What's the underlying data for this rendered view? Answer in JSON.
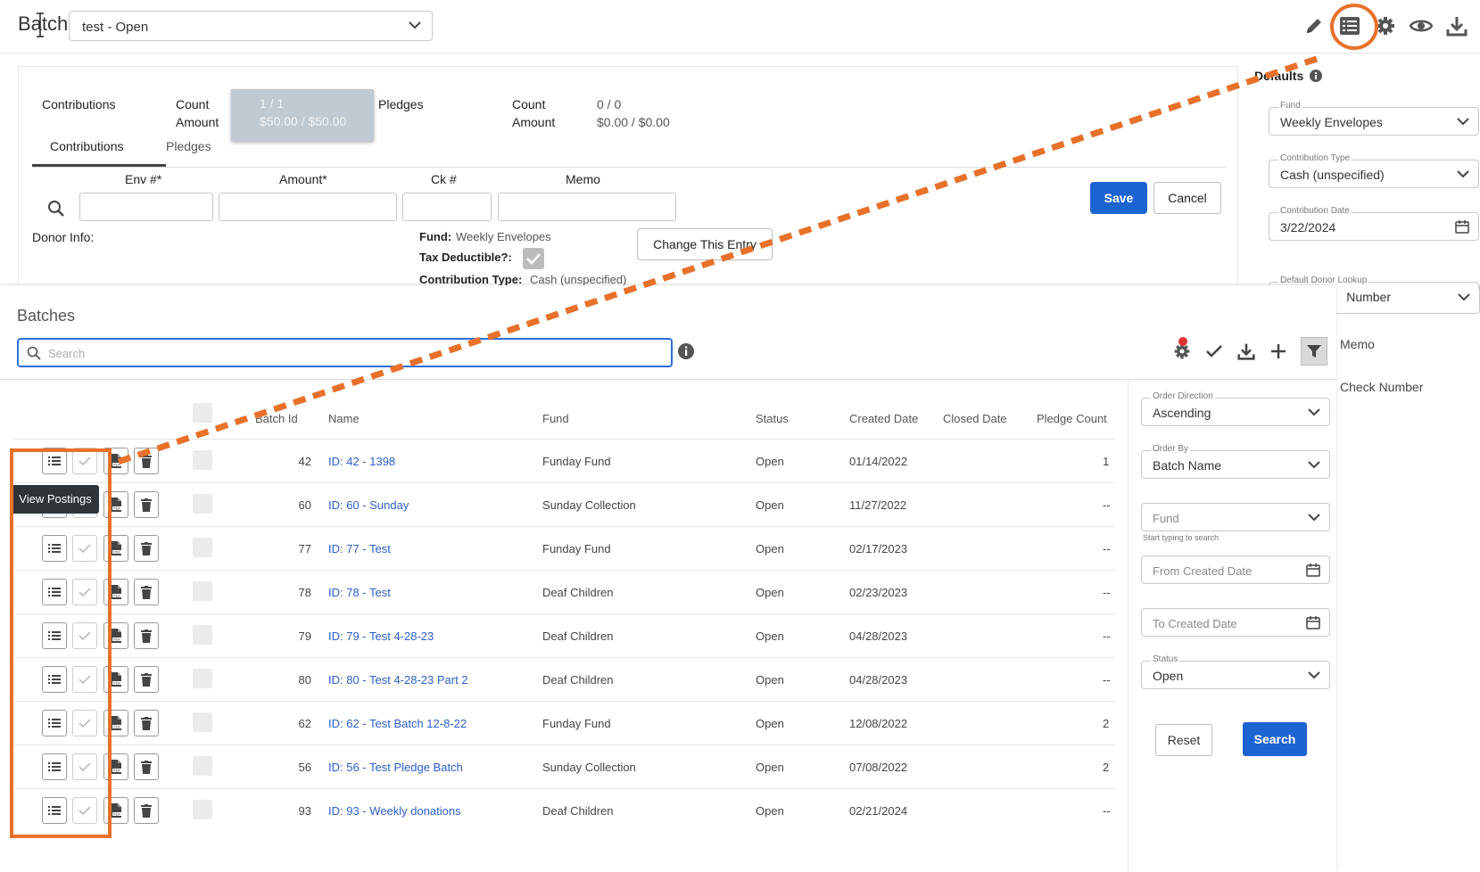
{
  "batch": {
    "title": "Batch",
    "selected": "test - Open"
  },
  "summary": {
    "contributions_label": "Contributions",
    "pledges_label": "Pledges",
    "count_label": "Count",
    "amount_label": "Amount",
    "contrib_count": "1 / 1",
    "contrib_amount": "$50.00 / $50.00",
    "pledge_count": "0 / 0",
    "pledge_amount": "$0.00 / $0.00"
  },
  "entry": {
    "tabs": [
      "Contributions",
      "Pledges"
    ],
    "columns": [
      "Env #*",
      "Amount*",
      "Ck #",
      "Memo"
    ],
    "save": "Save",
    "cancel": "Cancel",
    "donor_info_label": "Donor Info:",
    "fund_label": "Fund:",
    "fund_value": "Weekly Envelopes",
    "tax_label": "Tax Deductible?:",
    "ctype_label": "Contribution Type:",
    "ctype_value": "Cash (unspecified)",
    "change_button": "Change This Entry"
  },
  "defaults": {
    "title": "Defaults",
    "fund_label": "Fund",
    "fund_value": "Weekly Envelopes",
    "ctype_label": "Contribution Type",
    "ctype_value": "Cash (unspecified)",
    "date_label": "Contribution Date",
    "date_value": "3/22/2024",
    "lookup_label": "Default Donor Lookup",
    "lookup_value": "Number",
    "memo": "Memo",
    "check_number": "Check Number"
  },
  "batches": {
    "title": "Batches",
    "search_placeholder": "Search",
    "tooltip": "View Postings",
    "columns": {
      "batch_id": "Batch Id",
      "name": "Name",
      "fund": "Fund",
      "status": "Status",
      "created": "Created Date",
      "closed": "Closed Date",
      "pledge_count": "Pledge Count"
    },
    "rows": [
      {
        "id": "42",
        "name": "ID: 42 - 1398",
        "fund": "Funday Fund",
        "status": "Open",
        "created": "01/14/2022",
        "pledge": "1"
      },
      {
        "id": "60",
        "name": "ID: 60 - Sunday",
        "fund": "Sunday Collection",
        "status": "Open",
        "created": "11/27/2022",
        "pledge": "--"
      },
      {
        "id": "77",
        "name": "ID: 77 - Test",
        "fund": "Funday Fund",
        "status": "Open",
        "created": "02/17/2023",
        "pledge": "--"
      },
      {
        "id": "78",
        "name": "ID: 78 - Test",
        "fund": "Deaf Children",
        "status": "Open",
        "created": "02/23/2023",
        "pledge": "--"
      },
      {
        "id": "79",
        "name": "ID: 79 - Test 4-28-23",
        "fund": "Deaf Children",
        "status": "Open",
        "created": "04/28/2023",
        "pledge": "--"
      },
      {
        "id": "80",
        "name": "ID: 80 - Test 4-28-23 Part 2",
        "fund": "Deaf Children",
        "status": "Open",
        "created": "04/28/2023",
        "pledge": "--"
      },
      {
        "id": "62",
        "name": "ID: 62 - Test Batch 12-8-22",
        "fund": "Funday Fund",
        "status": "Open",
        "created": "12/08/2022",
        "pledge": "2"
      },
      {
        "id": "56",
        "name": "ID: 56 - Test Pledge Batch",
        "fund": "Sunday Collection",
        "status": "Open",
        "created": "07/08/2022",
        "pledge": "2"
      },
      {
        "id": "93",
        "name": "ID: 93 - Weekly donations",
        "fund": "Deaf Children",
        "status": "Open",
        "created": "02/21/2024",
        "pledge": "--"
      }
    ]
  },
  "filters": {
    "order_direction_label": "Order Direction",
    "order_direction_value": "Ascending",
    "order_by_label": "Order By",
    "order_by_value": "Batch Name",
    "fund_placeholder": "Fund",
    "fund_hint": "Start typing to search",
    "from_date_placeholder": "From Created Date",
    "to_date_placeholder": "To Created Date",
    "status_label": "Status",
    "status_value": "Open",
    "reset": "Reset",
    "search": "Search"
  },
  "colors": {
    "primary": "#1d64d3",
    "annotation": "#e8712a",
    "link": "#2a5fc9"
  },
  "icons": [
    "pencil-icon",
    "list-icon",
    "gear-icon",
    "eye-icon",
    "download-icon",
    "search-icon",
    "info-icon",
    "check-icon",
    "plus-icon",
    "filter-icon",
    "pdf-icon",
    "trash-icon",
    "calendar-icon",
    "chevron-down-icon"
  ]
}
